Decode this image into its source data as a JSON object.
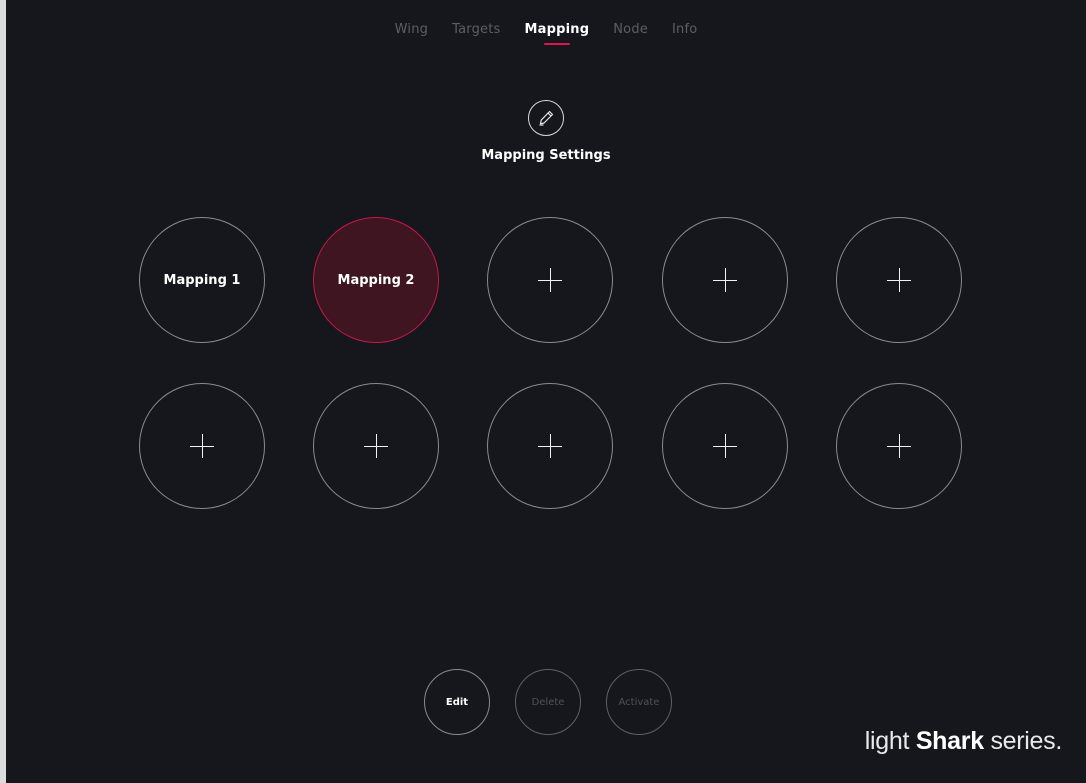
{
  "nav": {
    "tabs": [
      {
        "label": "Wing",
        "active": false
      },
      {
        "label": "Targets",
        "active": false
      },
      {
        "label": "Mapping",
        "active": true
      },
      {
        "label": "Node",
        "active": false
      },
      {
        "label": "Info",
        "active": false
      }
    ]
  },
  "header": {
    "icon": "pencil-icon",
    "title": "Mapping Settings"
  },
  "slots": [
    {
      "label": "Mapping 1",
      "state": "filled"
    },
    {
      "label": "Mapping 2",
      "state": "selected"
    },
    {
      "label": "",
      "state": "empty",
      "icon": "plus-icon"
    },
    {
      "label": "",
      "state": "empty",
      "icon": "plus-icon"
    },
    {
      "label": "",
      "state": "empty",
      "icon": "plus-icon"
    },
    {
      "label": "",
      "state": "empty",
      "icon": "plus-icon"
    },
    {
      "label": "",
      "state": "empty",
      "icon": "plus-icon"
    },
    {
      "label": "",
      "state": "empty",
      "icon": "plus-icon"
    },
    {
      "label": "",
      "state": "empty",
      "icon": "plus-icon"
    },
    {
      "label": "",
      "state": "empty",
      "icon": "plus-icon"
    }
  ],
  "actions": {
    "edit": {
      "label": "Edit",
      "enabled": true
    },
    "delete": {
      "label": "Delete",
      "enabled": false
    },
    "activate": {
      "label": "Activate",
      "enabled": false
    }
  },
  "brand": {
    "word1": "light",
    "word2": "Shark",
    "word3": "series."
  },
  "colors": {
    "background": "#16171c",
    "accent": "#e0134a",
    "selected_fill": "#3e1520"
  }
}
